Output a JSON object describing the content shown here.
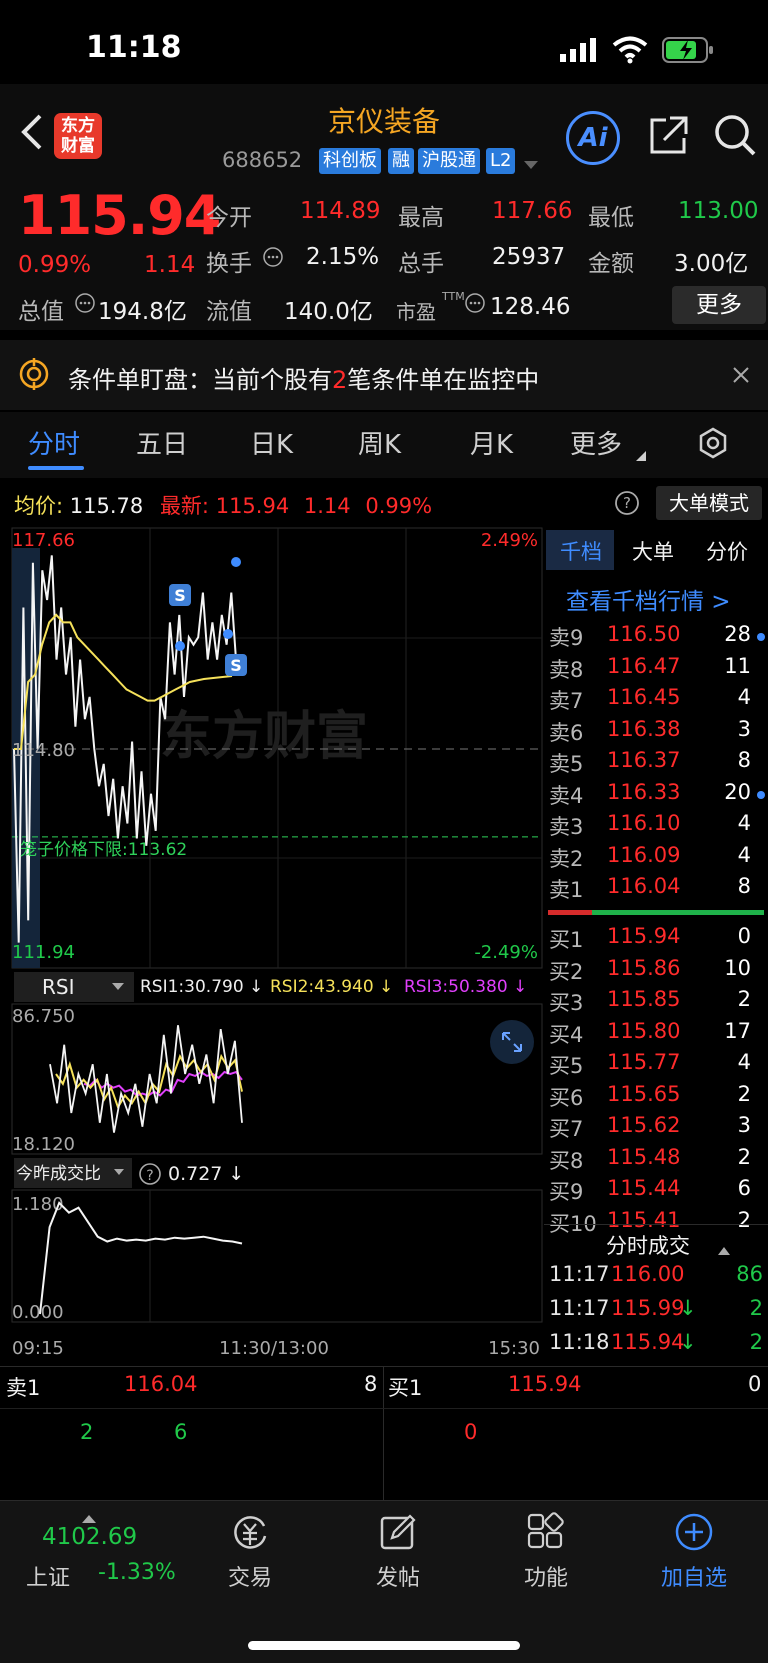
{
  "status_bar": {
    "time": "11:18"
  },
  "header": {
    "logo_text": "东方财富",
    "title": "京仪装备",
    "code": "688652",
    "tags": [
      "科创板",
      "融",
      "沪股通",
      "L2"
    ],
    "ai_label": "Ai"
  },
  "quote": {
    "price": "115.94",
    "change_pct": "0.99%",
    "change": "1.14",
    "open_label": "今开",
    "open": "114.89",
    "high_label": "最高",
    "high": "117.66",
    "low_label": "最低",
    "low": "113.00",
    "turnover_label": "换手",
    "turnover": "2.15%",
    "volume_label": "总手",
    "volume": "25937",
    "amount_label": "金额",
    "amount": "3.00亿",
    "mktcap_label": "总值",
    "mktcap": "194.8亿",
    "float_label": "流值",
    "float": "140.0亿",
    "pe_label": "市盈",
    "pe_sup": "TTM",
    "pe": "128.46",
    "more_button": "更多"
  },
  "notice": {
    "prefix": "条件单盯盘：当前个股有",
    "count": "2",
    "suffix": "笔条件单在监控中"
  },
  "tabs": [
    "分时",
    "五日",
    "日K",
    "周K",
    "月K",
    "更多"
  ],
  "chart_header": {
    "avg_label": "均价:",
    "avg_value": "115.78",
    "latest_label": "最新:",
    "latest_price": "115.94",
    "latest_change": "1.14",
    "latest_pct": "0.99%",
    "mode_button": "大单模式"
  },
  "chart_data": [
    {
      "type": "line",
      "y_top_label": "117.66",
      "y_mid_label": "114.80",
      "y_bottom_label": "111.94",
      "pct_top_label": "2.49%",
      "pct_bottom_label": "-2.49%",
      "limit_label": "笼子价格下限:",
      "limit_value": "113.62",
      "x_ticks": [
        "09:15",
        "11:30/13:00",
        "15:30"
      ],
      "ylim": [
        111.94,
        117.66
      ],
      "prev_close": 114.8,
      "series": [
        {
          "values": [
            114.8,
            112.2,
            116.7,
            112.5,
            117.3,
            114.8,
            117.2,
            116.8,
            117.4,
            116.0,
            116.7,
            115.8,
            116.3,
            115.1,
            116.0,
            115.2,
            115.5,
            114.8,
            114.3,
            114.6,
            113.9,
            114.4,
            113.6,
            114.3,
            113.8,
            114.9,
            113.6,
            114.5,
            113.5,
            114.2,
            113.7,
            115.5,
            115.2,
            116.5,
            115.8,
            116.6,
            115.5,
            116.3,
            116.2,
            116.3,
            116.9,
            116.0,
            116.5,
            116.0,
            116.6,
            116.2,
            116.9,
            116.0
          ]
        },
        {
          "values": [
            114.8,
            114.8,
            115.7,
            115.8,
            116.2,
            116.5,
            116.6,
            116.5,
            116.5,
            116.3,
            116.2,
            116.1,
            116.0,
            115.9,
            115.8,
            115.7,
            115.6,
            115.55,
            115.5,
            115.45,
            115.45,
            115.5,
            115.55,
            115.6,
            115.65,
            115.7,
            115.72,
            115.74,
            115.75,
            115.76,
            115.77,
            115.78
          ]
        }
      ]
    },
    {
      "type": "line",
      "indicator": "RSI",
      "legend": [
        "RSI1:30.790 ↓",
        "RSI2:43.940 ↓",
        "RSI3:50.380 ↓"
      ],
      "y_top_label": "86.750",
      "y_bottom_label": "18.120",
      "ylim": [
        18.12,
        86.75
      ],
      "series": [
        {
          "values": [
            60,
            40,
            70,
            35,
            55,
            45,
            60,
            30,
            55,
            25,
            45,
            35,
            50,
            28,
            55,
            40,
            75,
            45,
            80,
            55,
            70,
            50,
            65,
            40,
            78,
            55,
            72,
            30
          ]
        },
        {
          "values": [
            55,
            50,
            60,
            48,
            52,
            48,
            52,
            42,
            48,
            38,
            44,
            40,
            46,
            40,
            50,
            46,
            60,
            54,
            64,
            58,
            62,
            56,
            60,
            52,
            64,
            58,
            62,
            46
          ]
        },
        {
          "values": [
            50,
            49,
            52,
            48,
            50,
            48,
            49,
            46,
            47,
            44,
            45,
            44,
            46,
            44,
            47,
            46,
            52,
            51,
            55,
            54,
            56,
            54,
            55,
            53,
            56,
            55,
            56,
            52
          ]
        }
      ]
    },
    {
      "type": "line",
      "indicator": "今昨成交比",
      "value_label": "0.727 ↓",
      "y_top_label": "1.180",
      "y_bottom_label": "0.000",
      "ylim": [
        0,
        1.18
      ],
      "series": [
        {
          "values": [
            0.0,
            0.9,
            1.15,
            1.05,
            1.1,
            0.95,
            0.8,
            0.75,
            0.78,
            0.76,
            0.77,
            0.76,
            0.78,
            0.77,
            0.79,
            0.78,
            0.79,
            0.8,
            0.78,
            0.76,
            0.75,
            0.73
          ]
        }
      ]
    }
  ],
  "order_book": {
    "tabs": [
      "千档",
      "大单",
      "分价"
    ],
    "link": "查看千档行情 >",
    "asks": [
      {
        "label": "卖9",
        "price": "116.50",
        "vol": "28",
        "dot": true
      },
      {
        "label": "卖8",
        "price": "116.47",
        "vol": "11",
        "dot": false
      },
      {
        "label": "卖7",
        "price": "116.45",
        "vol": "4",
        "dot": false
      },
      {
        "label": "卖6",
        "price": "116.38",
        "vol": "3",
        "dot": false
      },
      {
        "label": "卖5",
        "price": "116.37",
        "vol": "8",
        "dot": false
      },
      {
        "label": "卖4",
        "price": "116.33",
        "vol": "20",
        "dot": true
      },
      {
        "label": "卖3",
        "price": "116.10",
        "vol": "4",
        "dot": false
      },
      {
        "label": "卖2",
        "price": "116.09",
        "vol": "4",
        "dot": false
      },
      {
        "label": "卖1",
        "price": "116.04",
        "vol": "8",
        "dot": false
      }
    ],
    "bids": [
      {
        "label": "买1",
        "price": "115.94",
        "vol": "0"
      },
      {
        "label": "买2",
        "price": "115.86",
        "vol": "10"
      },
      {
        "label": "买3",
        "price": "115.85",
        "vol": "2"
      },
      {
        "label": "买4",
        "price": "115.80",
        "vol": "17"
      },
      {
        "label": "买5",
        "price": "115.77",
        "vol": "4"
      },
      {
        "label": "买6",
        "price": "115.65",
        "vol": "2"
      },
      {
        "label": "买7",
        "price": "115.62",
        "vol": "3"
      },
      {
        "label": "买8",
        "price": "115.48",
        "vol": "2"
      },
      {
        "label": "买9",
        "price": "115.44",
        "vol": "6"
      },
      {
        "label": "买10",
        "price": "115.41",
        "vol": "2"
      }
    ],
    "ticks_title": "分时成交",
    "ticks": [
      {
        "time": "11:17",
        "price": "116.00",
        "arrow": "",
        "vol": "86"
      },
      {
        "time": "11:17",
        "price": "115.99",
        "arrow": "↓",
        "vol": "2"
      },
      {
        "time": "11:18",
        "price": "115.94",
        "arrow": "↓",
        "vol": "2"
      }
    ]
  },
  "l2_bar": {
    "ask_label": "卖1",
    "ask_price": "116.04",
    "ask_vol": "8",
    "bid_label": "买1",
    "bid_price": "115.94",
    "bid_vol": "0",
    "ask_queue": [
      "2",
      "6"
    ],
    "bid_queue": [
      "0"
    ]
  },
  "bottom_nav": {
    "index_value": "4102.69",
    "index_name": "上证",
    "index_pct": "-1.33%",
    "items": [
      "交易",
      "发帖",
      "功能",
      "加自选"
    ]
  },
  "watermark": "东方财富",
  "colors": {
    "up": "#ff2b2b",
    "down": "#20c94a",
    "accent": "#3f8cff",
    "avg_line": "#f5e15a",
    "brand": "#f5a623"
  }
}
